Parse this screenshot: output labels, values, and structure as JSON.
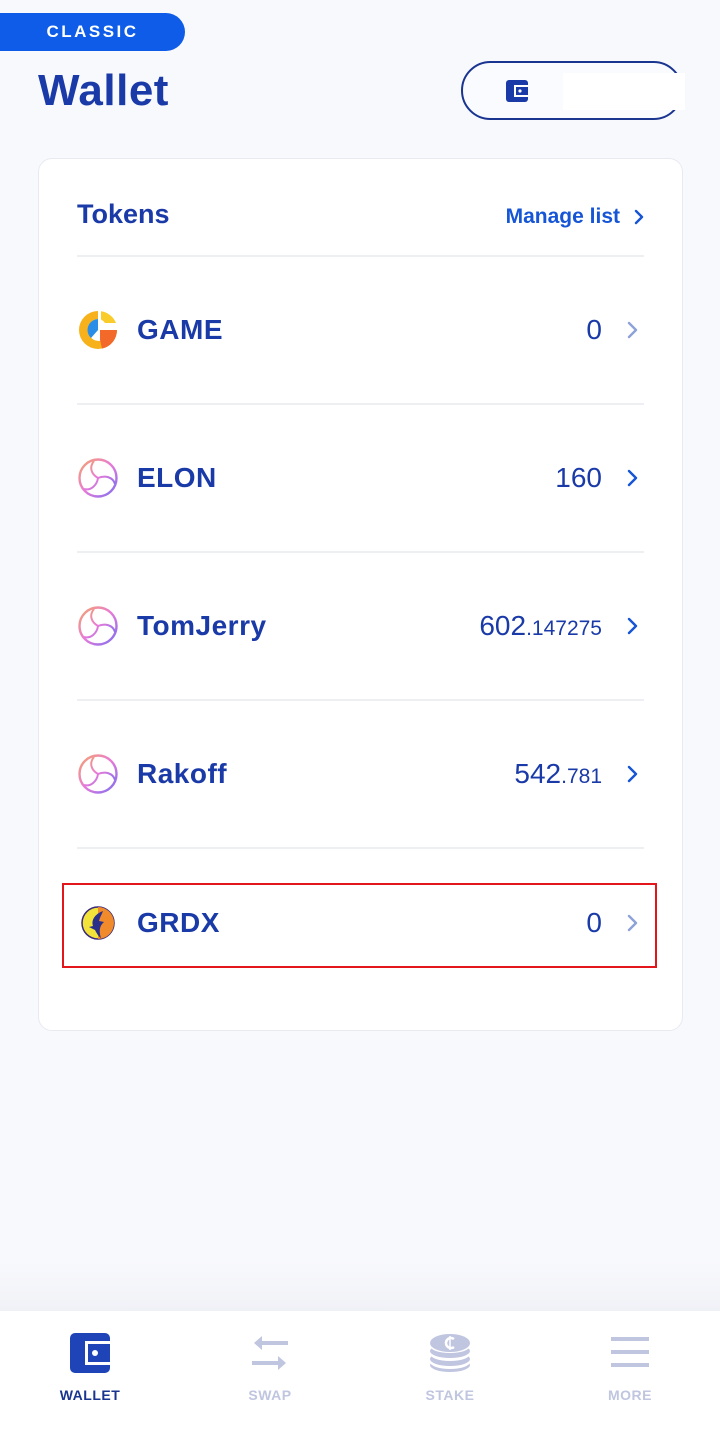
{
  "header": {
    "mode_badge": "CLASSIC",
    "title": "Wallet",
    "wallet_button_icon": "wallet-icon"
  },
  "tokens_card": {
    "title": "Tokens",
    "manage_label": "Manage list",
    "items": [
      {
        "name": "GAME",
        "balance_int": "0",
        "balance_dec": "",
        "icon": "game-token-icon",
        "highlighted": false
      },
      {
        "name": "ELON",
        "balance_int": "160",
        "balance_dec": "",
        "icon": "elon-token-icon",
        "highlighted": false
      },
      {
        "name": "TomJerry",
        "balance_int": "602",
        "balance_dec": ".147275",
        "icon": "tomjerry-token-icon",
        "highlighted": false
      },
      {
        "name": "Rakoff",
        "balance_int": "542",
        "balance_dec": ".781",
        "icon": "rakoff-token-icon",
        "highlighted": false
      },
      {
        "name": "GRDX",
        "balance_int": "0",
        "balance_dec": "",
        "icon": "grdx-token-icon",
        "highlighted": true
      }
    ]
  },
  "bottom_nav": {
    "items": [
      {
        "label": "WALLET",
        "icon": "wallet-icon",
        "active": true
      },
      {
        "label": "SWAP",
        "icon": "swap-arrows-icon",
        "active": false
      },
      {
        "label": "STAKE",
        "icon": "coin-stack-icon",
        "active": false
      },
      {
        "label": "MORE",
        "icon": "hamburger-menu-icon",
        "active": false
      }
    ]
  },
  "colors": {
    "primary": "#1a3aa8",
    "accent": "#0e5ce8",
    "highlight_border": "#e3161b",
    "inactive_nav": "#c0c5e0"
  }
}
